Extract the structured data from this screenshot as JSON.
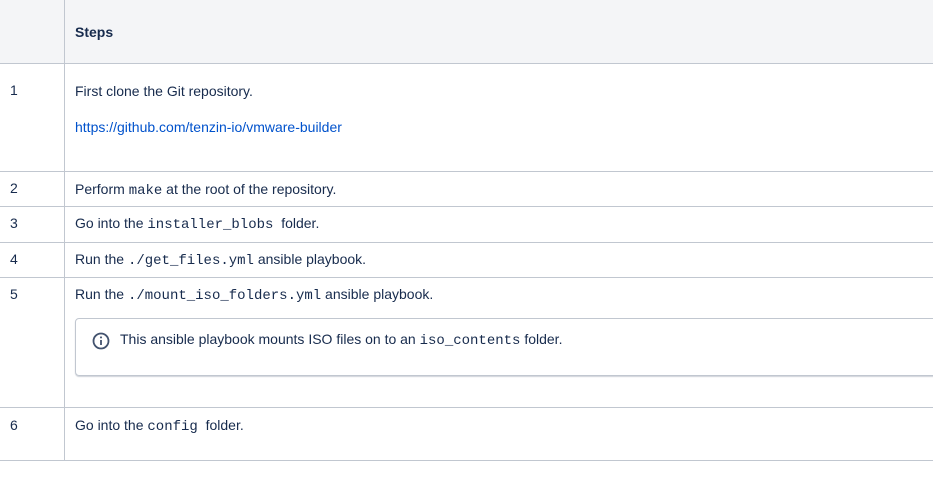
{
  "table": {
    "header": {
      "num": "",
      "steps": "Steps"
    },
    "rows": [
      {
        "num": "1",
        "text": "First clone the Git repository.",
        "link": "https://github.com/tenzin-io/vmware-builder"
      },
      {
        "num": "2",
        "pre": "Perform ",
        "code": "make",
        "post": " at the root of the repository."
      },
      {
        "num": "3",
        "pre": "Go into the ",
        "code": "installer_blobs",
        "post": "  folder."
      },
      {
        "num": "4",
        "pre": "Run the ",
        "code": "./get_files.yml",
        "post": " ansible playbook."
      },
      {
        "num": "5",
        "pre": "Run the ",
        "code": "./mount_iso_folders.yml",
        "post": " ansible playbook.",
        "note": {
          "icon": "info-icon",
          "pre": "This ansible playbook mounts ISO files on to an ",
          "code": "iso_contents",
          "post": " folder."
        }
      },
      {
        "num": "6",
        "pre": "Go into the ",
        "code": "config",
        "post": "  folder."
      }
    ]
  },
  "colors": {
    "link": "#0052cc",
    "border": "#c1c7d0",
    "header_bg": "#f4f5f7",
    "info_icon": "#42526e"
  }
}
